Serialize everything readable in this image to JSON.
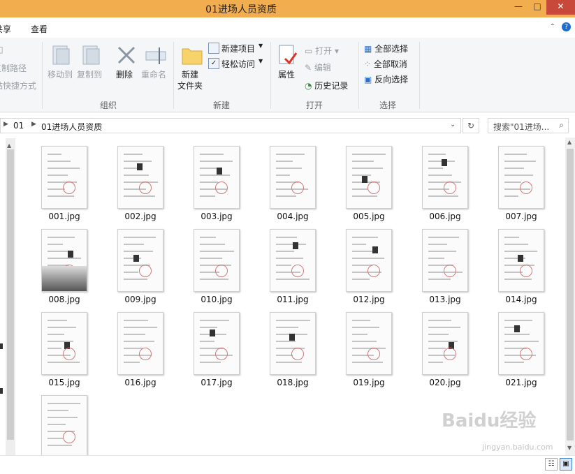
{
  "window": {
    "title": "01进场人员资质",
    "minimize": "—",
    "maximize": "□",
    "close": "✕"
  },
  "tabs": [
    "共享",
    "查看"
  ],
  "ribbon": {
    "clipboard_partial": [
      "复制路径",
      "粘贴快捷方式"
    ],
    "organize": {
      "move_to": "移动到",
      "copy_to": "复制到",
      "delete": "删除",
      "rename": "重命名",
      "group_label": "组织"
    },
    "new": {
      "new_folder": "新建\n文件夹",
      "new_item": "新建项目",
      "easy_access": "轻松访问",
      "group_label": "新建"
    },
    "open": {
      "properties": "属性",
      "open": "打开",
      "edit": "编辑",
      "history": "历史记录",
      "group_label": "打开"
    },
    "select": {
      "select_all": "全部选择",
      "select_none": "全部取消",
      "invert": "反向选择",
      "group_label": "选择"
    }
  },
  "address": {
    "crumbs": [
      "01",
      "01进场人员资质"
    ]
  },
  "search": {
    "placeholder": "搜索\"01进场..."
  },
  "files": [
    "001.jpg",
    "002.jpg",
    "003.jpg",
    "004.jpg",
    "005.jpg",
    "006.jpg",
    "007.jpg",
    "008.jpg",
    "009.jpg",
    "010.jpg",
    "011.jpg",
    "012.jpg",
    "013.jpg",
    "014.jpg",
    "015.jpg",
    "016.jpg",
    "017.jpg",
    "018.jpg",
    "019.jpg",
    "020.jpg",
    "021.jpg",
    ""
  ],
  "watermark": {
    "main": "Baidu经验",
    "url": "jingyan.baidu.com"
  }
}
